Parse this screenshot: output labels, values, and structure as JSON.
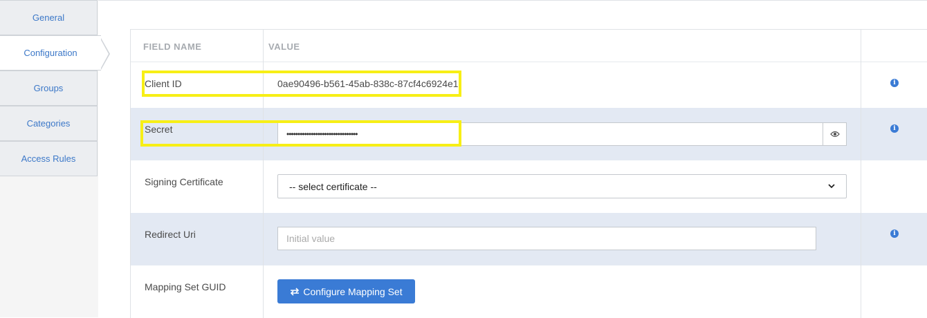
{
  "sidebar": {
    "tabs": [
      {
        "label": "General"
      },
      {
        "label": "Configuration"
      },
      {
        "label": "Groups"
      },
      {
        "label": "Categories"
      },
      {
        "label": "Access Rules"
      }
    ]
  },
  "table": {
    "headers": {
      "field_name": "FIELD NAME",
      "value": "VALUE"
    },
    "rows": {
      "client_id": {
        "label": "Client ID",
        "value": "0ae90496-b561-45ab-838c-87cf4c6924e1"
      },
      "secret": {
        "label": "Secret",
        "value": "••••••••••••••••••••••••••••••••"
      },
      "signing_certificate": {
        "label": "Signing Certificate",
        "selected": "-- select certificate --"
      },
      "redirect_uri": {
        "label": "Redirect Uri",
        "placeholder": "Initial value"
      },
      "mapping_set_guid": {
        "label": "Mapping Set GUID",
        "button_label": "Configure Mapping Set"
      }
    }
  },
  "colors": {
    "accent": "#3a7bd5",
    "highlight": "#f7ef16",
    "shaded_row": "#e3e9f3"
  },
  "icons": [
    "info-icon",
    "eye-icon",
    "exchange-icon",
    "chevron-down-icon"
  ]
}
